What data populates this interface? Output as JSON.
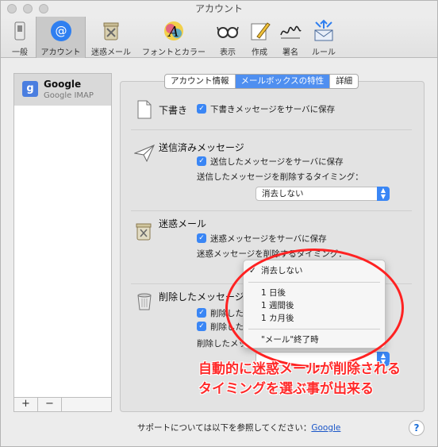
{
  "window": {
    "title": "アカウント"
  },
  "toolbar": {
    "items": [
      {
        "label": "一般",
        "icon": "general-switch-icon"
      },
      {
        "label": "アカウント",
        "icon": "at-icon"
      },
      {
        "label": "迷惑メール",
        "icon": "junk-trash-icon"
      },
      {
        "label": "フォントとカラー",
        "icon": "font-color-icon"
      },
      {
        "label": "表示",
        "icon": "glasses-icon"
      },
      {
        "label": "作成",
        "icon": "pencil-icon"
      },
      {
        "label": "署名",
        "icon": "signature-icon"
      },
      {
        "label": "ルール",
        "icon": "rules-envelope-icon"
      }
    ],
    "selected": "アカウント"
  },
  "sidebar": {
    "account": {
      "name": "Google",
      "type": "Google IMAP",
      "icon": "google-icon"
    },
    "add_label": "+",
    "remove_label": "−"
  },
  "tabs": {
    "items": [
      "アカウント情報",
      "メールボックスの特性",
      "詳細"
    ],
    "active": "メールボックスの特性"
  },
  "sections": {
    "drafts": {
      "title": "下書き",
      "checkbox": "下書きメッセージをサーバに保存"
    },
    "sent": {
      "title": "送信済みメッセージ",
      "checkbox": "送信したメッセージをサーバに保存",
      "timing_label": "送信したメッセージを削除するタイミング：",
      "select_value": "消去しない"
    },
    "junk": {
      "title": "迷惑メール",
      "checkbox": "迷惑メッセージをサーバに保存",
      "timing_label": "迷惑メッセージを削除するタイミング："
    },
    "trash": {
      "title": "削除したメッセージ",
      "checkbox1": "削除したメッセージをゴミ箱に移動",
      "checkbox2": "削除したメッセージをサーバに保存",
      "timing_label": "削除したメッセージを削除するタイミング："
    }
  },
  "dropdown": {
    "selected": "消去しない",
    "options": [
      "1 日後",
      "1 週間後",
      "1 カ月後"
    ],
    "quit_option": "\"メール\"終了時"
  },
  "footer": {
    "support_text": "サポートについては以下を参照してください：",
    "support_link": "Google",
    "help": "?"
  },
  "annotation": {
    "line1": "自動的に迷惑メールが削除される",
    "line2": "タイミングを選ぶ事が出来る",
    "color": "#ff2a2a"
  }
}
